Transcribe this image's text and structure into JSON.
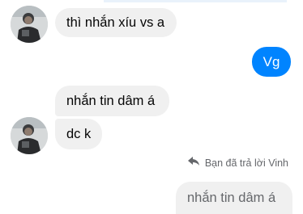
{
  "conversation": {
    "messages": [
      {
        "sender": "other",
        "text": "thì nhắn xíu vs a"
      },
      {
        "sender": "me",
        "text": "Vg"
      },
      {
        "sender": "other",
        "text": "nhắn tin dâm á"
      },
      {
        "sender": "other",
        "text": "dc k"
      }
    ],
    "reply": {
      "note": "Bạn đã trả lời Vinh",
      "quoted_text": "nhắn tin dâm á",
      "icon": "reply-arrow-icon"
    }
  },
  "colors": {
    "outgoing_bubble": "#0084ff",
    "incoming_bubble": "#f0f0f0",
    "secondary_text": "#65676b"
  }
}
